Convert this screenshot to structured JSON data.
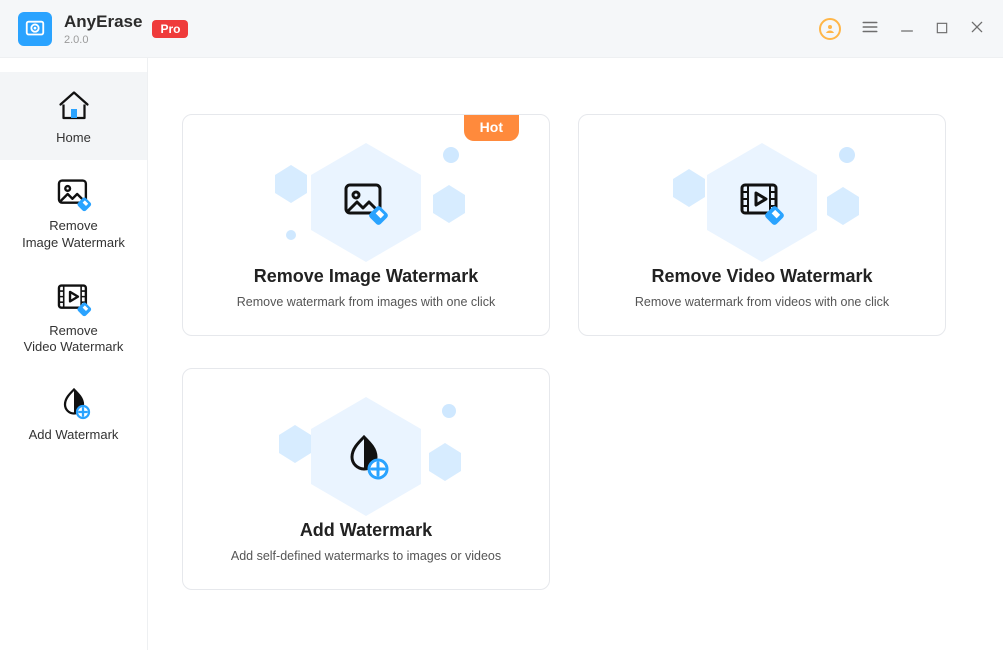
{
  "app": {
    "name": "AnyErase",
    "version": "2.0.0",
    "pro_badge": "Pro"
  },
  "sidebar": {
    "items": [
      {
        "id": "home",
        "label": "Home",
        "active": true
      },
      {
        "id": "rimg",
        "label": "Remove\nImage Watermark",
        "active": false
      },
      {
        "id": "rvid",
        "label": "Remove\nVideo Watermark",
        "active": false
      },
      {
        "id": "addwm",
        "label": "Add Watermark",
        "active": false
      }
    ]
  },
  "cards": {
    "remove_image": {
      "title": "Remove Image Watermark",
      "desc": "Remove watermark from images with one click",
      "hot_label": "Hot"
    },
    "remove_video": {
      "title": "Remove Video Watermark",
      "desc": "Remove watermark from videos with one click"
    },
    "add_wm": {
      "title": "Add Watermark",
      "desc": "Add self-defined watermarks to images or videos"
    }
  },
  "colors": {
    "accent": "#2aa3ff",
    "hot": "#ff8a3c",
    "pro": "#ef3b3b"
  }
}
